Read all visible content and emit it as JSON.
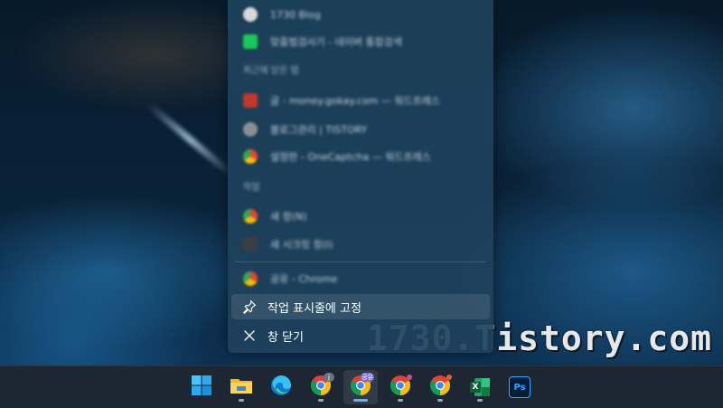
{
  "jumplist": {
    "top_items": [
      {
        "label": "1730 Blog",
        "icon": "site-favicon-icon",
        "color": "#d9d9d9"
      },
      {
        "label": "맞춤법검사기 - 네이버 통합검색",
        "icon": "naver-icon",
        "color": "#19c85a"
      }
    ],
    "recent_header": "최근에 닫은 탭",
    "recent_items": [
      {
        "label": "글 - money.gokay.com — 워드프레스",
        "icon": "site-favicon-icon",
        "color": "#c0392b"
      },
      {
        "label": "블로그관리 | TISTORY",
        "icon": "tistory-icon",
        "color": "#8a8f96"
      },
      {
        "label": "설정란 - OneCaptcha — 워드프레스",
        "icon": "chrome-icon",
        "color": "#e0b34a"
      }
    ],
    "tasks_header": "작업",
    "task_items": [
      {
        "label": "새 창(N)",
        "icon": "chrome-icon"
      },
      {
        "label": "새 시크릿 창(I)",
        "icon": "incognito-icon"
      }
    ],
    "app_item": {
      "label": "공유 - Chrome",
      "icon": "chrome-icon"
    },
    "actions": {
      "pin_label": "작업 표시줄에 고정",
      "close_label": "창 닫기"
    }
  },
  "watermark": "1730.Tistory.com",
  "taskbar": {
    "items": [
      {
        "name": "start-button",
        "icon": "windows-logo-icon"
      },
      {
        "name": "file-explorer-button",
        "icon": "folder-icon"
      },
      {
        "name": "edge-button",
        "icon": "edge-icon"
      },
      {
        "name": "chrome-profile-1-button",
        "icon": "chrome-icon",
        "badge": "j"
      },
      {
        "name": "chrome-profile-2-button",
        "icon": "chrome-icon",
        "badge": "공유",
        "active": true
      },
      {
        "name": "chrome-profile-3-button",
        "icon": "chrome-icon"
      },
      {
        "name": "chrome-profile-4-button",
        "icon": "chrome-icon"
      },
      {
        "name": "excel-button",
        "icon": "excel-icon"
      },
      {
        "name": "photoshop-button",
        "icon": "photoshop-icon",
        "label": "Ps"
      }
    ],
    "badge_1": "j",
    "badge_2": "공유",
    "ps_label": "Ps",
    "excel_label": "X"
  }
}
